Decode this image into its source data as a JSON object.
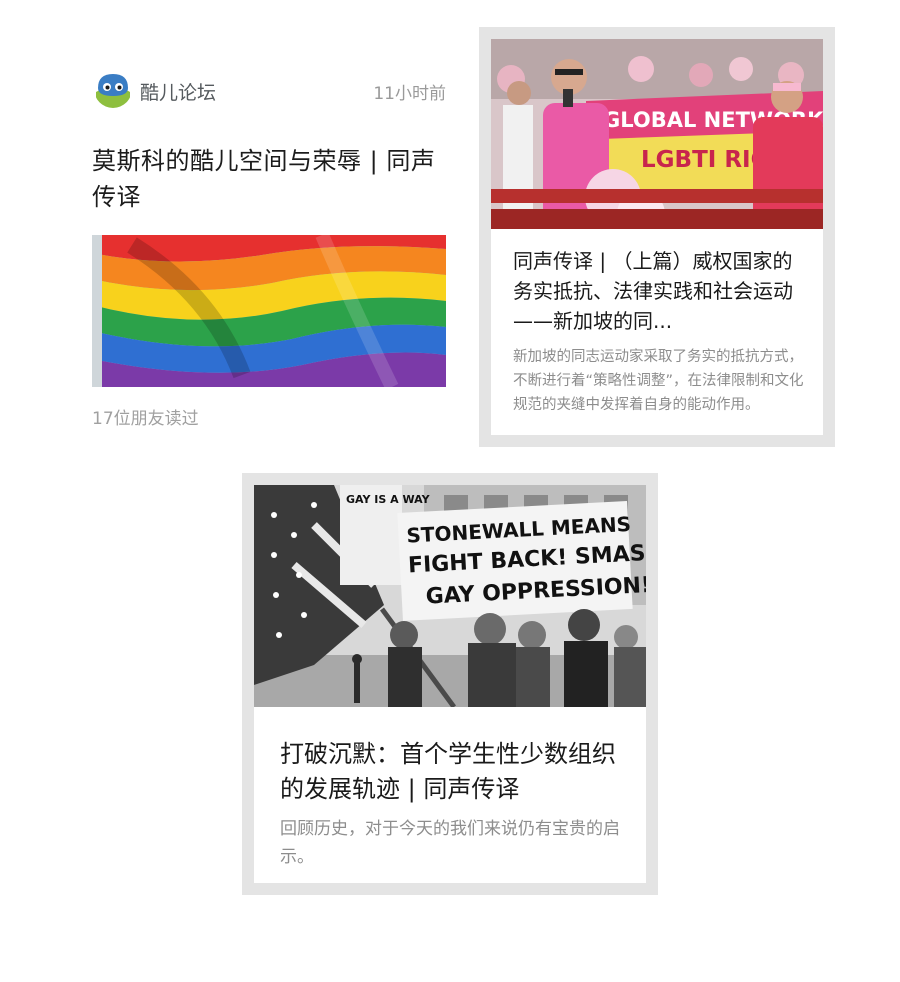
{
  "feed_card": {
    "author": "酷儿论坛",
    "timestamp": "11小时前",
    "title": "莫斯科的酷儿空间与荣辱 | 同声传译",
    "image_icon": "rainbow-flag-image",
    "read_count": "17位朋友读过"
  },
  "related_articles": [
    {
      "image_icon": "pride-parade-photo",
      "image_banner_text": "GLOBAL NETWORK\nLGBTI RIG",
      "title": "同声传译 | （上篇）威权国家的务实抵抗、法律实践和社会运动——新加坡的同...",
      "description": "新加坡的同志运动家采取了务实的抵抗方式，不断进行着“策略性调整”，在法律限制和文化规范的夹缝中发挥着自身的能动作用。"
    },
    {
      "image_icon": "stonewall-protest-photo",
      "image_sign_text": [
        "STONEWALL MEANS",
        "FIGHT BACK! SMASH",
        "GAY OPPRESSION!"
      ],
      "image_sign_small": "GAY IS A WAY",
      "title": "打破沉默：首个学生性少数组织的发展轨迹 | 同声传译",
      "description": "回顾历史，对于今天的我们来说仍有宝贵的启示。"
    }
  ],
  "colors": {
    "frame": "#e4e4e4",
    "title_text": "#1a1a1a",
    "muted_text": "#8d8d8d",
    "avatar_blue": "#3a7dc4",
    "avatar_green": "#8ebf3f"
  }
}
